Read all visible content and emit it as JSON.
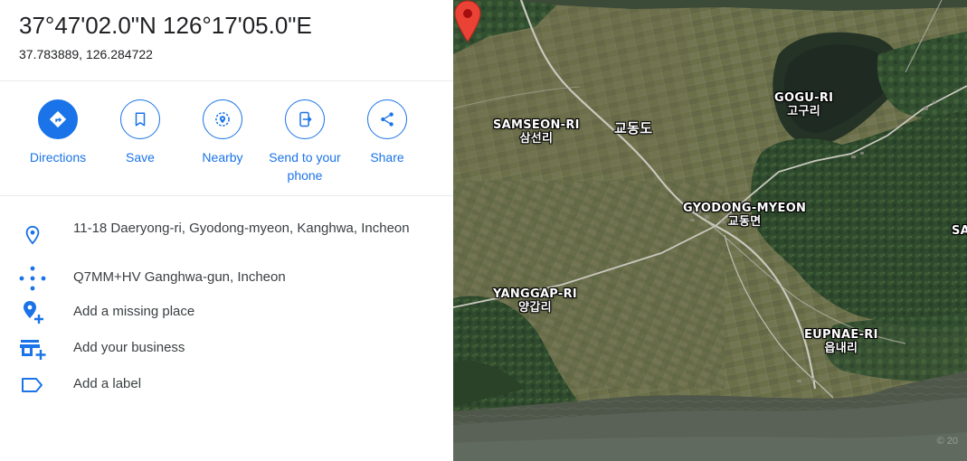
{
  "place": {
    "coordinates_dms": "37°47'02.0\"N 126°17'05.0\"E",
    "coordinates_decimal": "37.783889, 126.284722"
  },
  "actions": [
    {
      "label": "Directions",
      "icon": "directions-icon"
    },
    {
      "label": "Save",
      "icon": "bookmark-icon"
    },
    {
      "label": "Nearby",
      "icon": "nearby-icon"
    },
    {
      "label": "Send to your phone",
      "icon": "send-to-phone-icon"
    },
    {
      "label": "Share",
      "icon": "share-icon"
    }
  ],
  "info": {
    "address": "11-18 Daeryong-ri, Gyodong-myeon, Kanghwa, Incheon",
    "plus_code": "Q7MM+HV Ganghwa-gun, Incheon",
    "add_missing_place": "Add a missing place",
    "add_business": "Add your business",
    "add_label": "Add a label"
  },
  "map": {
    "view": "satellite",
    "labels": {
      "samseon_en": "SAMSEON-RI",
      "samseon_ko": "삼선리",
      "gyodongdo_ko": "교동도",
      "gogu_en": "GOGU-RI",
      "gogu_ko": "고구리",
      "gyodong_en": "GYODONG-MYEON",
      "gyodong_ko": "교동면",
      "sa_partial": "SA",
      "yanggap_en": "YANGGAP-RI",
      "yanggap_ko": "양갑리",
      "eupnae_en": "EUPNAE-RI",
      "eupnae_ko": "읍내리"
    },
    "watermark": "© 20"
  },
  "colors": {
    "accent": "#1a73e8",
    "pin": "#ea4335"
  }
}
